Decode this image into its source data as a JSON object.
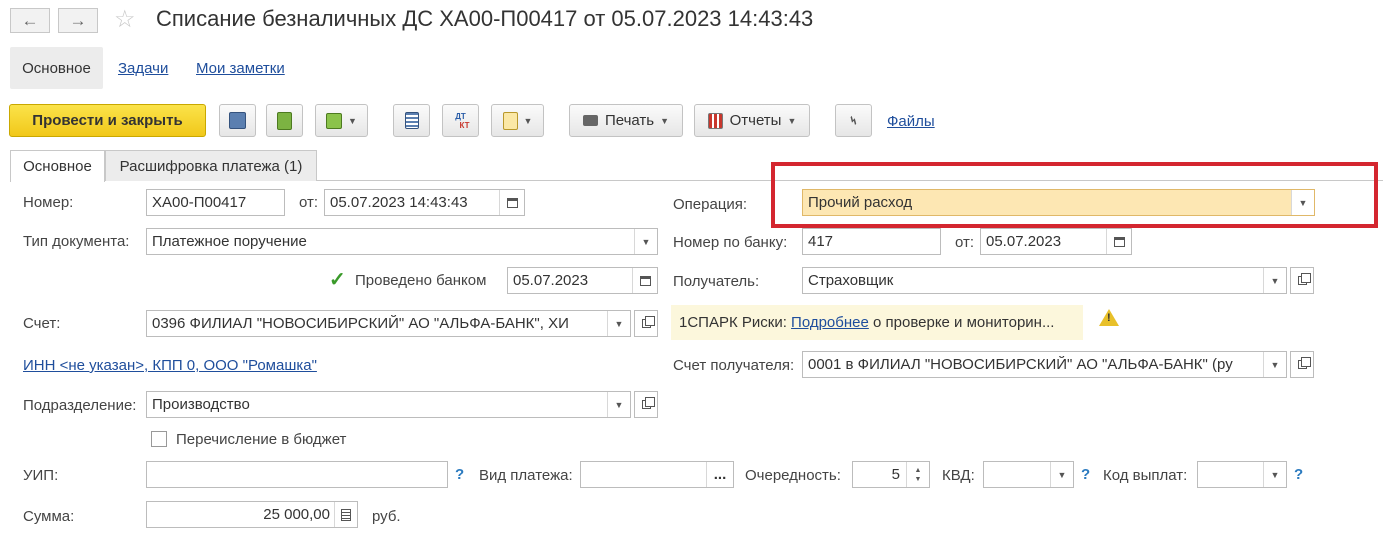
{
  "window": {
    "title": "Списание безналичных ДС ХА00-П00417 от 05.07.2023 14:43:43"
  },
  "nav": {
    "back_icon": "arrow-left-icon",
    "forward_icon": "arrow-right-icon",
    "favorite_icon": "star-icon"
  },
  "sections": {
    "main": "Основное",
    "tasks": "Задачи",
    "notes": "Мои заметки"
  },
  "toolbar": {
    "post_close": "Провести и закрыть",
    "print": "Печать",
    "reports": "Отчеты",
    "files": "Файлы",
    "dt_kt_top": "ДТ",
    "dt_kt_bottom": "КТ"
  },
  "tabs": [
    {
      "label": "Основное"
    },
    {
      "label": "Расшифровка платежа (1)"
    }
  ],
  "form": {
    "number_label": "Номер:",
    "number_value": "ХА00-П00417",
    "from_label": "от:",
    "date_value": "05.07.2023 14:43:43",
    "doc_type_label": "Тип документа:",
    "doc_type_value": "Платежное поручение",
    "posted_label": "Проведено банком",
    "posted_date": "05.07.2023",
    "posted_checked": true,
    "account_label": "Счет:",
    "account_value": "0396  ФИЛИАЛ \"НОВОСИБИРСКИЙ\" АО \"АЛЬФА-БАНК\", ХИ",
    "inn_link": "ИНН <не указан>, КПП 0, ООО \"Ромашка\"",
    "dept_label": "Подразделение:",
    "dept_value": "Производство",
    "budget_label": "Перечисление в бюджет",
    "budget_checked": false,
    "uip_label": "УИП:",
    "uip_value": "",
    "payment_kind_label": "Вид платежа:",
    "payment_kind_value": "",
    "priority_label": "Очередность:",
    "priority_value": "5",
    "kvd_label": "КВД:",
    "kvd_value": "",
    "payout_code_label": "Код выплат:",
    "payout_code_value": "",
    "sum_label": "Сумма:",
    "sum_value": "25 000,00",
    "currency": "руб.",
    "operation_label": "Операция:",
    "operation_value": "Прочий расход",
    "bank_number_label": "Номер по банку:",
    "bank_number_value": "417",
    "bank_from_label": "от:",
    "bank_date_value": "05.07.2023",
    "recipient_label": "Получатель:",
    "recipient_value": "Страховщик",
    "spark_prefix": "1СПАРК Риски:",
    "spark_link": "Подробнее",
    "spark_suffix": "о проверке и мониторин...",
    "recipient_account_label": "Счет получателя:",
    "recipient_account_value": "0001 в ФИЛИАЛ \"НОВОСИБИРСКИЙ\" АО \"АЛЬФА-БАНК\" (ру",
    "question_mark": "?",
    "ellipsis": "..."
  },
  "colors": {
    "primary_button": "#f1c81a",
    "highlight_frame": "#d4262f",
    "operation_bg": "#fde7b3",
    "link": "#1f4e9c"
  }
}
